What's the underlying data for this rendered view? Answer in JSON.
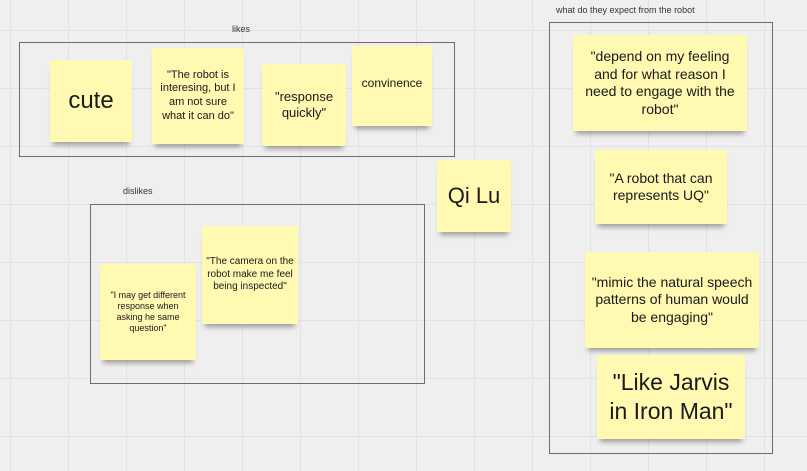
{
  "frames": {
    "likes": {
      "label": "likes"
    },
    "dislikes": {
      "label": "dislikes"
    },
    "expect": {
      "label": "what do they expect from the robot"
    }
  },
  "notes": {
    "cute": "cute",
    "robot_interesting": "\"The robot is interesing, but I am not sure what it can do\"",
    "response_quickly": "\"response quickly\"",
    "convinence": "convinence",
    "qi_lu": "Qi Lu",
    "different_response": "\"I may get different response when asking he same question\"",
    "camera_inspected": "\"The camera on the robot make me feel being inspected\"",
    "depend_feeling": "\"depend on my feeling and for what reason I need to engage with the robot\"",
    "represents_uq": "\"A robot that can represents UQ\"",
    "mimic_speech": "\"mimic the natural speech patterns of human would be engaging\"",
    "like_jarvis": "\"Like Jarvis in Iron Man\""
  },
  "colors": {
    "sticky": "#fff9b1",
    "canvas": "#efefef",
    "frame_border": "#6d6d6d"
  }
}
